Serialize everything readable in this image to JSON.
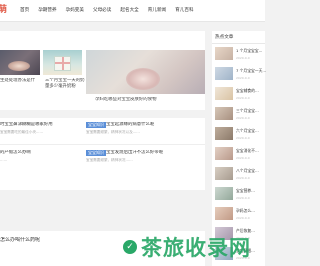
{
  "header": {
    "logo_char": "萌",
    "nav": [
      "首页",
      "孕期营养",
      "孕妈变美",
      "父母必读",
      "起名大全",
      "育儿新闻",
      "育儿百科"
    ]
  },
  "feature": {
    "cards": [
      {
        "caption": "生处处理办法是什"
      },
      {
        "caption": "三个月宝宝一天的奶量多少毫升奶粉"
      },
      {
        "caption": "孕妇吃哪些对宝宝皮肤好的食物"
      }
    ]
  },
  "list": {
    "rows": [
      {
        "tag": "",
        "title": "时宝宝鼻涕糊糊是哪家好用",
        "desc": "宝宝需要吃的最佳小块……"
      },
      {
        "tag": "宝宝知识",
        "title": "宝宝起源缘的病意什么呢",
        "desc": "宝宝需要频繁，精神状况以及……"
      },
      {
        "tag": "宝宝知识",
        "title": "宝宝发烧后出汗不怎么好带呢",
        "desc": "宝宝需要频繁，精神状况……"
      },
      {
        "tag": "",
        "title": "的产假怎么办啊",
        "desc": "……"
      }
    ],
    "bottom_title": "怎么办喝什么药呢"
  },
  "sidebar": {
    "title": "热点文章",
    "items": [
      {
        "text": "1 个月宝宝宝…",
        "date": "2020-0-0"
      },
      {
        "text": "7 个月宝宝一天…",
        "date": "2020-0-0"
      },
      {
        "text": "宝宝辅食的…",
        "date": "2020-0-0"
      },
      {
        "text": "三个月宝宝…",
        "date": "2020-0-0"
      },
      {
        "text": "六个月宝宝…",
        "date": "2020-0-0"
      },
      {
        "text": "宝宝消化不…",
        "date": "2020-0-0"
      },
      {
        "text": "八个月宝宝…",
        "date": "2020-0-0"
      },
      {
        "text": "宝宝营养…",
        "date": "2020-0-0"
      },
      {
        "text": "孕妈怎么…",
        "date": "2020-0-0"
      },
      {
        "text": "产后恢复…",
        "date": "2020-0-0"
      },
      {
        "text": "宝宝睡眠…",
        "date": "2020-0-0"
      }
    ]
  },
  "watermark": {
    "text": "茶旅收录网"
  },
  "colors": {
    "accent": "#e05a47",
    "tag": "#5b8fd8",
    "watermark": "#2aa868"
  }
}
